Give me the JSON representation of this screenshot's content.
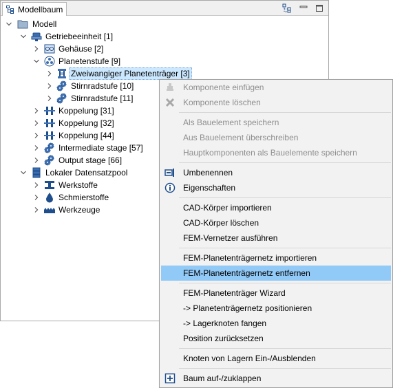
{
  "panel": {
    "title": "Modellbaum"
  },
  "tree": {
    "root": "Modell",
    "getriebeeinheit": "Getriebeeinheit [1]",
    "gehaeuse": "Gehäuse [2]",
    "planetenstufe": "Planetenstufe [9]",
    "zweiwangiger": "Zweiwangiger Planetenträger [3]",
    "stirnradstufe10": "Stirnradstufe [10]",
    "stirnradstufe11": "Stirnradstufe [11]",
    "koppelung31": "Koppelung [31]",
    "koppelung32": "Koppelung [32]",
    "koppelung44": "Koppelung [44]",
    "intermediate": "Intermediate stage [57]",
    "output": "Output stage [66]",
    "pool": "Lokaler Datensatzpool",
    "werkstoffe": "Werkstoffe",
    "schmierstoffe": "Schmierstoffe",
    "werkzeuge": "Werkzeuge"
  },
  "menu": {
    "komponente_einfuegen": "Komponente einfügen",
    "komponente_loeschen": "Komponente löschen",
    "als_bauelement": "Als Bauelement speichern",
    "aus_bauelement": "Aus Bauelement überschreiben",
    "hauptkomponenten": "Hauptkomponenten als Bauelemente speichern",
    "umbenennen": "Umbenennen",
    "eigenschaften": "Eigenschaften",
    "cad_import": "CAD-Körper importieren",
    "cad_loeschen": "CAD-Körper löschen",
    "fem_vernetzer": "FEM-Vernetzer ausführen",
    "fem_netz_import": "FEM-Planetenträgernetz importieren",
    "fem_netz_entfernen": "FEM-Planetenträgernetz entfernen",
    "fem_wizard": "FEM-Planetenträger Wizard",
    "netz_positionieren": "->  Planetenträgernetz positionieren",
    "lagerknoten": "->  Lagerknoten fangen",
    "position_reset": "Position zurücksetzen",
    "knoten_lagern": "Knoten von Lagern Ein-/Ausblenden",
    "baum_klappen": "Baum auf-/zuklappen"
  },
  "colors": {
    "selection": "#cce8ff",
    "menu_highlight": "#91c9f7",
    "icon_blue": "#1f4e8c"
  }
}
